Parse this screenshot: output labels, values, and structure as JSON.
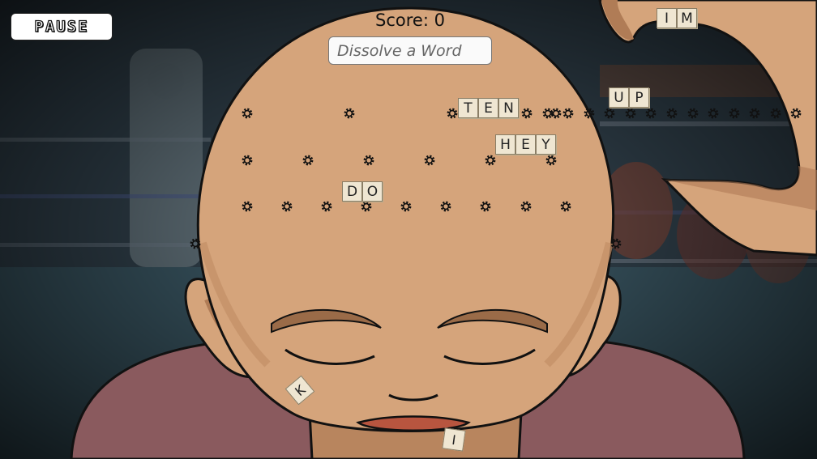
{
  "hud": {
    "pause_label": "PAUSE",
    "score_label": "Score:",
    "score_value": "0",
    "input_placeholder": "Dissolve a Word"
  },
  "falling_words": [
    {
      "id": "word-ten",
      "letters": [
        "T",
        "E",
        "N"
      ]
    },
    {
      "id": "word-up",
      "letters": [
        "U",
        "P"
      ]
    },
    {
      "id": "word-hey",
      "letters": [
        "H",
        "E",
        "Y"
      ]
    },
    {
      "id": "word-do",
      "letters": [
        "D",
        "O"
      ]
    },
    {
      "id": "word-im",
      "letters": [
        "I",
        "M"
      ]
    }
  ],
  "loose_letters": [
    {
      "id": "letter-k",
      "letter": "K"
    },
    {
      "id": "letter-i",
      "letter": "I"
    }
  ],
  "colors": {
    "skin": "#d5a47b",
    "skin_shadow": "#b07c56",
    "shirt": "#8a5a5e",
    "tile": "#efe6d2",
    "background": "#1e2a33"
  }
}
